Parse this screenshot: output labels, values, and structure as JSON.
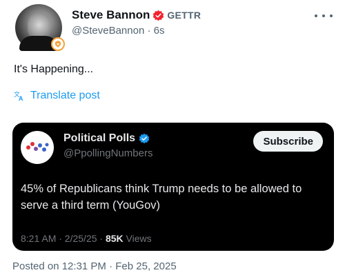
{
  "author": {
    "name": "Steve Bannon",
    "affiliation": "GETTR",
    "handle": "@SteveBannon",
    "time_ago": "6s"
  },
  "post": {
    "text": "It's Happening...",
    "translate_label": "Translate post",
    "posted_on": "Posted on 12:31 PM · Feb 25, 2025"
  },
  "quoted_post": {
    "author_name": "Political Polls",
    "handle": "@PpollingNumbers",
    "subscribe_label": "Subscribe",
    "text": "45% of Republicans think Trump needs to be allowed to serve a third term (YouGov)",
    "timestamp": "8:21 AM · 2/25/25 · ",
    "views_count": "85K",
    "views_label": "Views"
  },
  "colors": {
    "accent_blue": "#1d9bf0",
    "verified_red": "#f4212e",
    "badge_orange": "#f4a23a",
    "card_background": "#000000"
  },
  "icons": {
    "author_verified": "verified-badge-red-icon",
    "avatar_badge": "affiliation-badge-icon",
    "translate": "translate-icon",
    "more": "more-options-icon",
    "quoted_verified": "verified-badge-blue-icon",
    "quoted_logo": "political-polls-logo"
  }
}
